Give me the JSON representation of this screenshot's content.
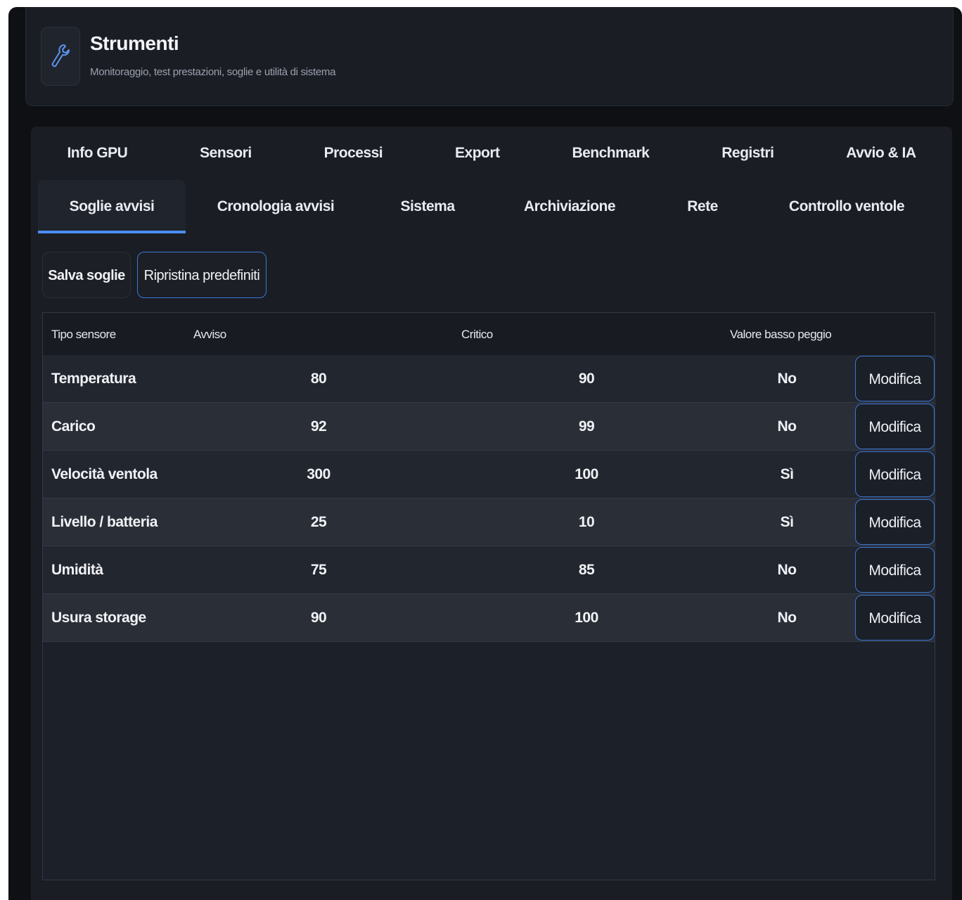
{
  "header": {
    "title": "Strumenti",
    "subtitle": "Monitoraggio, test prestazioni, soglie e utilità di sistema",
    "icon": "wrench-icon"
  },
  "tabs_row1": [
    "Info GPU",
    "Sensori",
    "Processi",
    "Export",
    "Benchmark",
    "Registri",
    "Avvio & IA"
  ],
  "tabs_row2": [
    "Soglie avvisi",
    "Cronologia avvisi",
    "Sistema",
    "Archiviazione",
    "Rete",
    "Controllo ventole"
  ],
  "active_tab": "Soglie avvisi",
  "actions": {
    "save_label": "Salva soglie",
    "reset_label": "Ripristina predefiniti"
  },
  "table": {
    "columns": [
      "Tipo sensore",
      "Avviso",
      "Critico",
      "Valore basso peggio"
    ],
    "edit_label": "Modifica",
    "rows": [
      {
        "sensor": "Temperatura",
        "warning": "80",
        "critical": "90",
        "low_worse": "No"
      },
      {
        "sensor": "Carico",
        "warning": "92",
        "critical": "99",
        "low_worse": "No"
      },
      {
        "sensor": "Velocità ventola",
        "warning": "300",
        "critical": "100",
        "low_worse": "Sì"
      },
      {
        "sensor": "Livello / batteria",
        "warning": "25",
        "critical": "10",
        "low_worse": "Sì"
      },
      {
        "sensor": "Umidità",
        "warning": "75",
        "critical": "85",
        "low_worse": "No"
      },
      {
        "sensor": "Usura storage",
        "warning": "90",
        "critical": "100",
        "low_worse": "No"
      }
    ]
  },
  "colors": {
    "accent": "#4a8df0",
    "background": "#0e1014",
    "panel": "#1a1d24"
  }
}
